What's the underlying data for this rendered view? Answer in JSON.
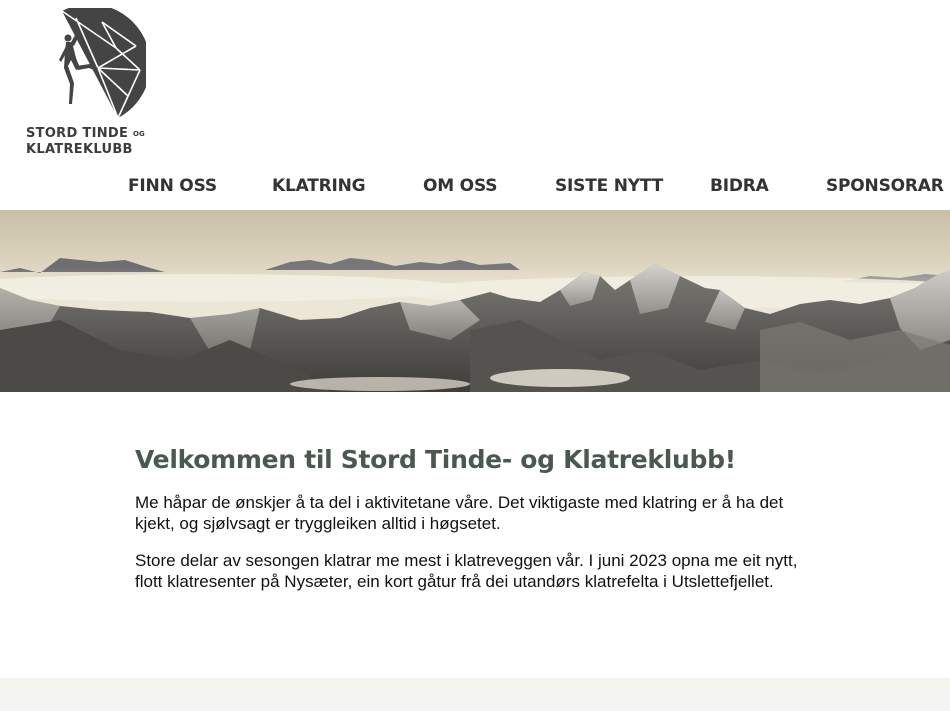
{
  "logo": {
    "line1": "STORD TINDE",
    "line1_suffix": "OG",
    "line2": "KLATREKLUBB",
    "icon": "climber-mountain-logo-icon"
  },
  "nav": {
    "items": [
      {
        "label": "FINN OSS"
      },
      {
        "label": "KLATRING"
      },
      {
        "label": "OM OSS"
      },
      {
        "label": "SISTE NYTT"
      },
      {
        "label": "BIDRA"
      },
      {
        "label": "SPONSORAR"
      }
    ]
  },
  "hero": {
    "image": "mountain-panorama-image"
  },
  "content": {
    "heading": "Velkommen til Stord Tinde- og Klatreklubb!",
    "paragraphs": [
      "Me håpar de ønskjer å ta del i aktivitetane våre. Det viktigaste med klatring er å ha det kjekt, og sjølvsagt er tryggleiken alltid i høgsetet.",
      "Store delar av sesongen klatrar me mest i klatreveggen vår. I juni 2023 opna me eit nytt, flott klatresenter på Nysæter, ein kort gåtur frå dei utandørs klatrefelta i Utslettefjellet."
    ]
  },
  "colors": {
    "heading": "#4b584f",
    "nav": "#333333",
    "logo": "#3c3c3c",
    "footer": "#f3f3ef"
  }
}
